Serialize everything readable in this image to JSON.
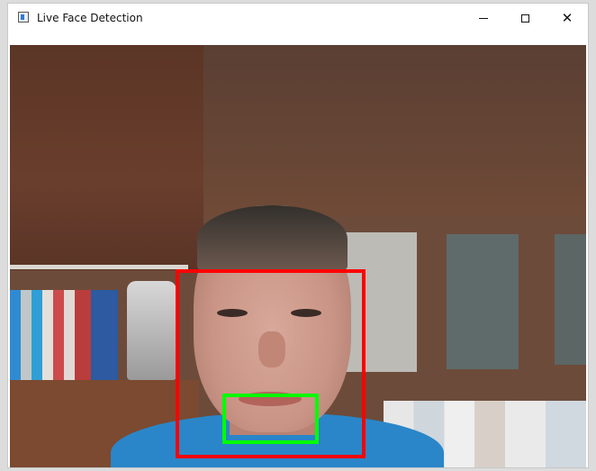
{
  "window": {
    "title": "Live Face Detection",
    "icons": {
      "app": "window-app-icon",
      "minimize": "minimize-icon",
      "maximize": "maximize-icon",
      "close": "close-icon"
    },
    "close_glyph": "✕"
  },
  "detections": [
    {
      "label": "face",
      "color": "#ff0000"
    },
    {
      "label": "mouth",
      "color": "#00ff00"
    }
  ]
}
